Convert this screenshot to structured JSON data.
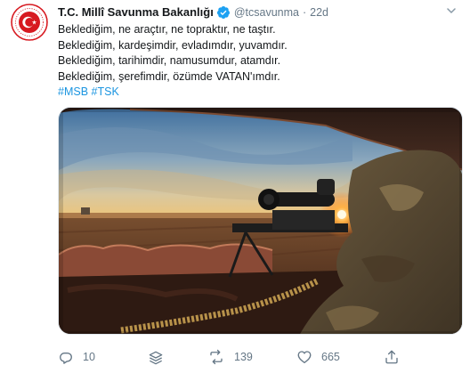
{
  "tweet": {
    "display_name": "T.C. Millî Savunma Bakanlığı",
    "handle": "@tcsavunma",
    "separator": "·",
    "time": "22d",
    "lines": [
      "Beklediğim, ne araçtır, ne topraktır, ne taştır.",
      "Beklediğim, kardeşimdir, evladımdır, yuvamdır.",
      "Beklediğim, tarihimdir, namusumdur, atamdır.",
      "Beklediğim, şerefimdir, özümde VATAN'ımdır."
    ],
    "hashtags": [
      "#MSB",
      "#TSK"
    ]
  },
  "actions": {
    "reply_count": "10",
    "retweet_count": "139",
    "like_count": "665"
  },
  "icons": {
    "avatar": "msb-emblem",
    "verified": "verified-badge-icon",
    "caret": "chevron-down-icon",
    "reply": "reply-icon",
    "thread": "thread-icon",
    "retweet": "retweet-icon",
    "like": "heart-icon",
    "share": "share-icon"
  },
  "colors": {
    "accent": "#1b95e0",
    "muted": "#657786",
    "emblem_red": "#d71920"
  }
}
